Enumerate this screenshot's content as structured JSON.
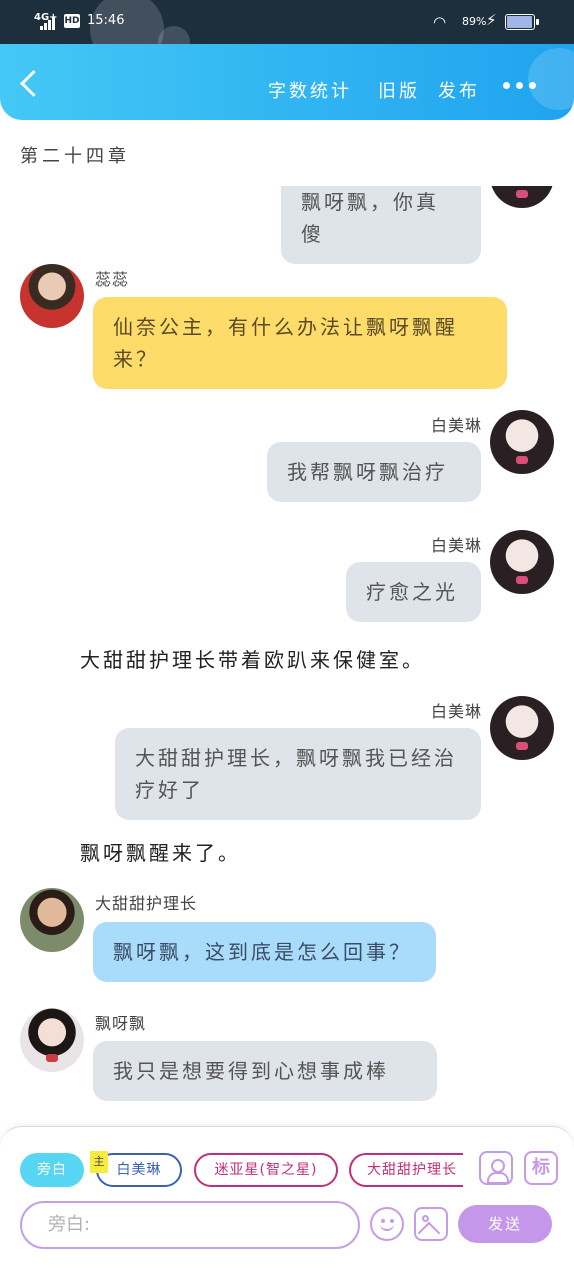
{
  "status_bar": {
    "network": "4G+",
    "hd": "HD",
    "time": "15:46",
    "battery_percent": "89%",
    "battery_level": 0.89,
    "icons": [
      "signal-icon",
      "wifi-icon",
      "charging-icon",
      "battery-icon"
    ]
  },
  "app_bar": {
    "back_icon": "chevron-left-icon",
    "word_count": "字数统计",
    "old_version": "旧版",
    "publish": "发布",
    "more_icon": "more-dots-icon",
    "color": "#1fa3ef"
  },
  "chapter": "第二十四章",
  "messages": [
    {
      "type": "bubble",
      "side": "right",
      "speaker": "",
      "text": "飘呀飘，你真傻",
      "color": "#dfe3ea"
    },
    {
      "type": "bubble",
      "side": "left",
      "speaker": "蕊蕊",
      "text": "仙奈公主，有什么办法让飘呀飘醒来？",
      "color": "#fddc6a"
    },
    {
      "type": "bubble",
      "side": "right",
      "speaker": "白美琳",
      "text": "我帮飘呀飘治疗",
      "color": "#dfe3ea"
    },
    {
      "type": "bubble",
      "side": "right",
      "speaker": "白美琳",
      "text": "疗愈之光",
      "color": "#dfe3ea"
    },
    {
      "type": "narration",
      "text": "大甜甜护理长带着欧趴来保健室。"
    },
    {
      "type": "bubble",
      "side": "right",
      "speaker": "白美琳",
      "text": "大甜甜护理长，飘呀飘我已经治疗好了",
      "color": "#dfe3ea"
    },
    {
      "type": "narration",
      "text": "飘呀飘醒来了。"
    },
    {
      "type": "bubble",
      "side": "left",
      "speaker": "大甜甜护理长",
      "text": "飘呀飘，这到底是怎么回事？",
      "color": "#a9dcfb"
    },
    {
      "type": "bubble",
      "side": "left",
      "speaker": "飘呀飘",
      "text": "我只是想要得到心想事成棒",
      "color": "#dfe3ea"
    }
  ],
  "roles": [
    {
      "label": "旁白",
      "color": "#57d6f4"
    },
    {
      "label": "白美琳",
      "color": "#3a61b3",
      "badge": "主"
    },
    {
      "label": "迷亚星(智之星)",
      "color": "#c42e77"
    },
    {
      "label": "大甜甜护理长",
      "color": "#c42e77"
    }
  ],
  "tools": {
    "add_role_icon": "person-icon",
    "tag_icon_label": "标"
  },
  "input": {
    "placeholder": "旁白:",
    "emoji_icon": "emoji-icon",
    "image_icon": "image-icon",
    "send_label": "发送",
    "accent": "#c497ea"
  }
}
